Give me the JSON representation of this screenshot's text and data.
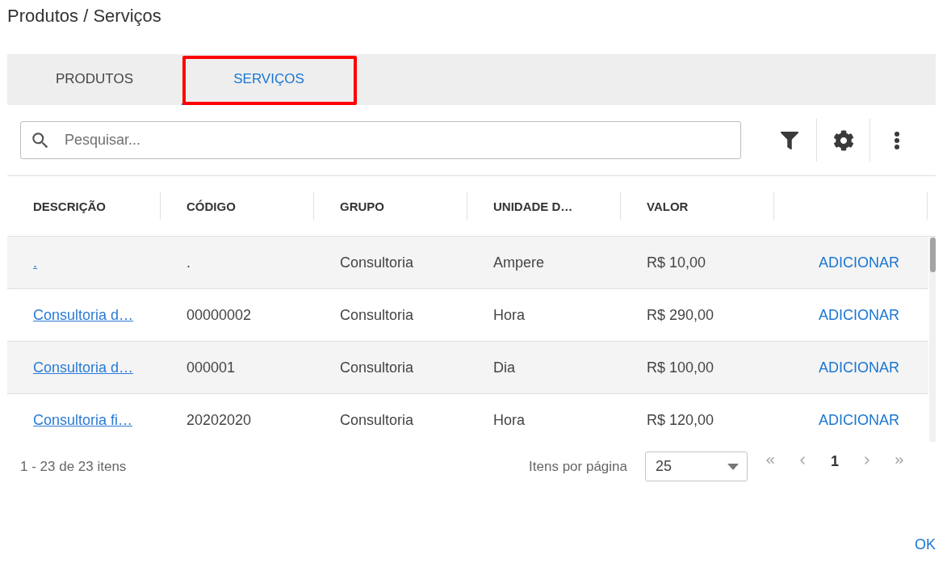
{
  "title": "Produtos / Serviços",
  "tabs": [
    {
      "label": "PRODUTOS",
      "selected": false,
      "highlighted": false
    },
    {
      "label": "SERVIÇOS",
      "selected": true,
      "highlighted": true
    }
  ],
  "search": {
    "placeholder": "Pesquisar..."
  },
  "table": {
    "columns": [
      "DESCRIÇÃO",
      "CÓDIGO",
      "GRUPO",
      "UNIDADE D…",
      "VALOR"
    ],
    "rows": [
      {
        "description": ".",
        "code": ".",
        "group": "Consultoria",
        "unit": "Ampere",
        "value": "R$ 10,00",
        "action": "ADICIONAR"
      },
      {
        "description": "Consultoria d…",
        "code": "00000002",
        "group": "Consultoria",
        "unit": "Hora",
        "value": "R$ 290,00",
        "action": "ADICIONAR"
      },
      {
        "description": "Consultoria d…",
        "code": "000001",
        "group": "Consultoria",
        "unit": "Dia",
        "value": "R$ 100,00",
        "action": "ADICIONAR"
      },
      {
        "description": "Consultoria fi…",
        "code": "20202020",
        "group": "Consultoria",
        "unit": "Hora",
        "value": "R$ 120,00",
        "action": "ADICIONAR"
      }
    ]
  },
  "pagination": {
    "summary": "1 - 23 de 23 itens",
    "page_size_label": "Itens por página",
    "page_size": "25",
    "pages": [
      {
        "label": "1",
        "selected": true
      }
    ]
  },
  "ok_button": "OK"
}
